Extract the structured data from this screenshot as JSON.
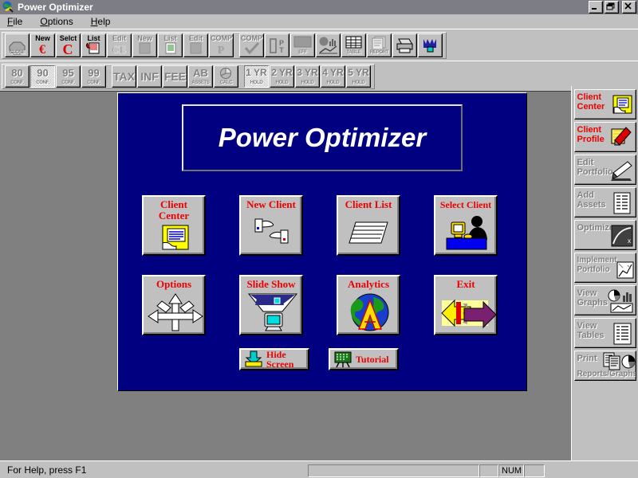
{
  "window": {
    "title": "Power Optimizer",
    "icon": "app-globe-icon",
    "minimize": "–",
    "restore": "❐",
    "close": "✕"
  },
  "menu": {
    "items": [
      {
        "label": "File",
        "accel": "F"
      },
      {
        "label": "Options",
        "accel": "O"
      },
      {
        "label": "Help",
        "accel": "H"
      }
    ]
  },
  "toolbar1": {
    "buttons": [
      {
        "name": "close-client",
        "top": "",
        "bottom": "CLOSE",
        "icon": "octagon-icon",
        "enabled": true,
        "pressed": false
      },
      {
        "name": "new-client-euro",
        "top": "New",
        "bottom": "",
        "icon": "euro-c-icon",
        "enabled": true,
        "pressed": false
      },
      {
        "name": "select-client",
        "top": "Selct",
        "bottom": "",
        "icon": "red-c-icon",
        "enabled": true,
        "pressed": false
      },
      {
        "name": "client-list",
        "top": "List",
        "bottom": "",
        "icon": "scroll-icon",
        "enabled": true,
        "pressed": false
      },
      {
        "name": "edit-client-ce",
        "top": "Edit",
        "bottom": "",
        "icon": "ce-icon",
        "enabled": false,
        "pressed": false
      },
      {
        "name": "new-portfolio",
        "top": "New",
        "bottom": "",
        "icon": "document-icon",
        "enabled": false,
        "pressed": false
      },
      {
        "name": "list-portfolio",
        "top": "List",
        "bottom": "",
        "icon": "lined-doc-icon",
        "enabled": false,
        "pressed": false
      },
      {
        "name": "edit-portfolio",
        "top": "Edit",
        "bottom": "",
        "icon": "document-icon",
        "enabled": false,
        "pressed": false
      },
      {
        "name": "comp-p",
        "top": "COMP",
        "bottom": "",
        "icon": "comp-p-icon",
        "enabled": false,
        "pressed": false
      },
      {
        "name": "comp-check",
        "top": "COMP",
        "bottom": "",
        "icon": "checkmark-icon",
        "enabled": true,
        "pressed": false
      },
      {
        "name": "optimize-opt",
        "top": "",
        "bottom": "",
        "icon": "opt-icon",
        "enabled": true,
        "pressed": false
      },
      {
        "name": "efficient-frontier",
        "top": "",
        "bottom": "EFF",
        "icon": "monitor-icon",
        "enabled": false,
        "pressed": false
      },
      {
        "name": "view-graphs",
        "top": "",
        "bottom": "",
        "icon": "pie-bar-chart-icon",
        "enabled": true,
        "pressed": false
      },
      {
        "name": "view-tables",
        "top": "",
        "bottom": "TABLE",
        "icon": "table-icon",
        "enabled": true,
        "pressed": false
      },
      {
        "name": "reports",
        "top": "",
        "bottom": "REPORT",
        "icon": "report-icon",
        "enabled": false,
        "pressed": false
      },
      {
        "name": "print",
        "top": "",
        "bottom": "",
        "icon": "printer-icon",
        "enabled": true,
        "pressed": false
      },
      {
        "name": "tutorial-blue",
        "top": "",
        "bottom": "",
        "icon": "blue-crown-icon",
        "enabled": true,
        "pressed": false
      }
    ]
  },
  "toolbar2": {
    "buttons": [
      {
        "name": "confidence-80",
        "top": "80",
        "bottom": "CONF.",
        "enabled": true,
        "pressed": false
      },
      {
        "name": "confidence-90",
        "top": "90",
        "bottom": "CONF.",
        "enabled": true,
        "pressed": true
      },
      {
        "name": "confidence-95",
        "top": "95",
        "bottom": "CONF.",
        "enabled": true,
        "pressed": false
      },
      {
        "name": "confidence-99",
        "top": "99",
        "bottom": "CONF.",
        "enabled": true,
        "pressed": false
      },
      {
        "name": "tax",
        "top": "TAX",
        "bottom": "",
        "enabled": true,
        "pressed": false
      },
      {
        "name": "inflation",
        "top": "INF",
        "bottom": "",
        "enabled": true,
        "pressed": false
      },
      {
        "name": "fees",
        "top": "FEE",
        "bottom": "",
        "enabled": true,
        "pressed": false
      },
      {
        "name": "assets-ab",
        "top": "AB",
        "bottom": "ASSETS",
        "enabled": true,
        "pressed": false
      },
      {
        "name": "calc",
        "top": "",
        "bottom": "CALC",
        "enabled": true,
        "pressed": false
      },
      {
        "name": "hold-1yr",
        "top": "1 YR",
        "bottom": "HOLD",
        "enabled": true,
        "pressed": true
      },
      {
        "name": "hold-2yr",
        "top": "2 YR",
        "bottom": "HOLD",
        "enabled": true,
        "pressed": false
      },
      {
        "name": "hold-3yr",
        "top": "3 YR",
        "bottom": "HOLD",
        "enabled": true,
        "pressed": false
      },
      {
        "name": "hold-4yr",
        "top": "4 YR",
        "bottom": "HOLD",
        "enabled": true,
        "pressed": false
      },
      {
        "name": "hold-5yr",
        "top": "5 YR",
        "bottom": "HOLD",
        "enabled": true,
        "pressed": false
      }
    ]
  },
  "main": {
    "banner_title": "Power Optimizer",
    "buttons": [
      {
        "name": "client-center",
        "line1": "Client",
        "line2": "Center",
        "icon": "yellow-folder-monitor-icon"
      },
      {
        "name": "new-client",
        "line1": "New Client",
        "line2": "",
        "icon": "hands-exchange-icon"
      },
      {
        "name": "client-list",
        "line1": "Client List",
        "line2": "",
        "icon": "lined-paper-icon"
      },
      {
        "name": "select-client",
        "line1": "Select Client",
        "line2": "",
        "icon": "person-at-desk-icon"
      },
      {
        "name": "options",
        "line1": "Options",
        "line2": "",
        "icon": "multi-arrow-icon"
      },
      {
        "name": "slide-show",
        "line1": "Slide Show",
        "line2": "",
        "icon": "projector-screen-icon"
      },
      {
        "name": "analytics",
        "line1": "Analytics",
        "line2": "",
        "icon": "globe-a-icon"
      },
      {
        "name": "exit",
        "line1": "Exit",
        "line2": "",
        "icon": "double-arrow-icon"
      }
    ],
    "small_buttons": [
      {
        "name": "hide-screen",
        "line1": "Hide",
        "line2": "Screen",
        "icon": "down-arrow-tray-icon"
      },
      {
        "name": "tutorial",
        "line1": "Tutorial",
        "line2": "",
        "icon": "chalkboard-icon"
      }
    ]
  },
  "sidebar": {
    "items": [
      {
        "name": "client-center",
        "line1": "Client",
        "line2": "Center",
        "sub": "",
        "enabled": true,
        "icon": "yellow-note-icon"
      },
      {
        "name": "client-profile",
        "line1": "Client",
        "line2": "Profile",
        "sub": "",
        "enabled": true,
        "icon": "red-pencil-icon"
      },
      {
        "name": "edit-portfolio",
        "line1": "Edit",
        "line2": "Portfolio",
        "sub": "",
        "enabled": false,
        "icon": "pencil-paper-icon"
      },
      {
        "name": "add-assets",
        "line1": "Add",
        "line2": "Assets",
        "sub": "",
        "enabled": false,
        "icon": "lined-list-icon"
      },
      {
        "name": "optimize",
        "line1": "Optimize",
        "line2": "",
        "sub": "",
        "enabled": false,
        "icon": "curve-graph-icon"
      },
      {
        "name": "implement-portfolio",
        "line1": "Implement",
        "line2": "Portfolio",
        "sub": "",
        "enabled": false,
        "icon": "scatter-chart-icon"
      },
      {
        "name": "view-graphs",
        "line1": "View",
        "line2": "Graphs",
        "sub": "",
        "enabled": false,
        "icon": "charts-icon"
      },
      {
        "name": "view-tables",
        "line1": "View",
        "line2": "Tables",
        "sub": "",
        "enabled": false,
        "icon": "table-lines-icon"
      },
      {
        "name": "print-reports",
        "line1": "Print",
        "line2": "",
        "sub": "Reports/Graphs",
        "enabled": false,
        "icon": "printer-pie-icon"
      }
    ]
  },
  "statusbar": {
    "help_text": "For Help, press F1",
    "num_indicator": "NUM"
  },
  "colors": {
    "titlebar": "#7d7d85",
    "face": "#c0c0c0",
    "navy": "#000080",
    "mdi_background": "#808080",
    "label_red": "#ee0000",
    "disabled_gray": "#808080"
  }
}
